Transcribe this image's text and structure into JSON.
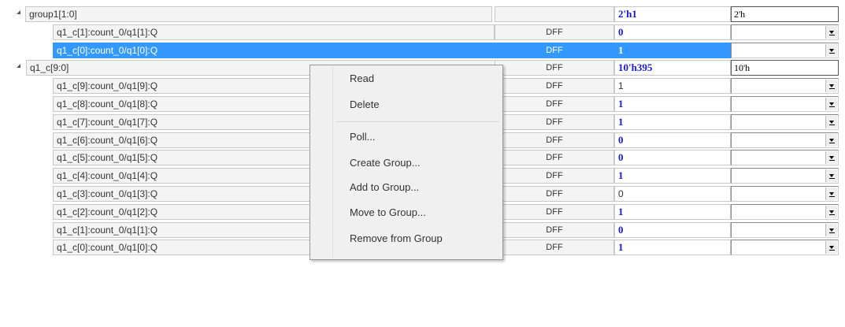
{
  "tree": {
    "groups": [
      {
        "label": "group1[1:0]",
        "type": "",
        "value": "2'h1",
        "edit": "2'h",
        "children": [
          {
            "label": "q1_c[1]:count_0/q1[1]:Q",
            "type": "DFF",
            "value": "0",
            "value_style": "bold"
          },
          {
            "label": "q1_c[0]:count_0/q1[0]:Q",
            "type": "DFF",
            "value": "1",
            "value_style": "bold",
            "selected": true
          }
        ]
      },
      {
        "label": "q1_c[9:0]",
        "type": "DFF",
        "value": "10'h395",
        "edit": "10'h",
        "children": [
          {
            "label": "q1_c[9]:count_0/q1[9]:Q",
            "type": "DFF",
            "value": "1",
            "value_style": "plain"
          },
          {
            "label": "q1_c[8]:count_0/q1[8]:Q",
            "type": "DFF",
            "value": "1",
            "value_style": "bold"
          },
          {
            "label": "q1_c[7]:count_0/q1[7]:Q",
            "type": "DFF",
            "value": "1",
            "value_style": "bold"
          },
          {
            "label": "q1_c[6]:count_0/q1[6]:Q",
            "type": "DFF",
            "value": "0",
            "value_style": "bold"
          },
          {
            "label": "q1_c[5]:count_0/q1[5]:Q",
            "type": "DFF",
            "value": "0",
            "value_style": "bold"
          },
          {
            "label": "q1_c[4]:count_0/q1[4]:Q",
            "type": "DFF",
            "value": "1",
            "value_style": "bold"
          },
          {
            "label": "q1_c[3]:count_0/q1[3]:Q",
            "type": "DFF",
            "value": "0",
            "value_style": "plain"
          },
          {
            "label": "q1_c[2]:count_0/q1[2]:Q",
            "type": "DFF",
            "value": "1",
            "value_style": "bold"
          },
          {
            "label": "q1_c[1]:count_0/q1[1]:Q",
            "type": "DFF",
            "value": "0",
            "value_style": "bold"
          },
          {
            "label": "q1_c[0]:count_0/q1[0]:Q",
            "type": "DFF",
            "value": "1",
            "value_style": "bold"
          }
        ]
      }
    ]
  },
  "context_menu": {
    "items": [
      {
        "label": "Read",
        "sep_after": false
      },
      {
        "label": "Delete",
        "sep_after": true
      },
      {
        "label": "Poll...",
        "sep_after": false
      },
      {
        "label": "Create Group...",
        "sep_after": false
      },
      {
        "label": "Add to Group...",
        "sep_after": false
      },
      {
        "label": "Move to Group...",
        "sep_after": false
      },
      {
        "label": "Remove from Group",
        "sep_after": false
      }
    ]
  },
  "colors": {
    "selection": "#3399ff",
    "value_blue": "#1a1acc"
  },
  "icons": {
    "expander": "expanded-triangle-icon",
    "dropdown": "dropdown-arrow-icon"
  }
}
